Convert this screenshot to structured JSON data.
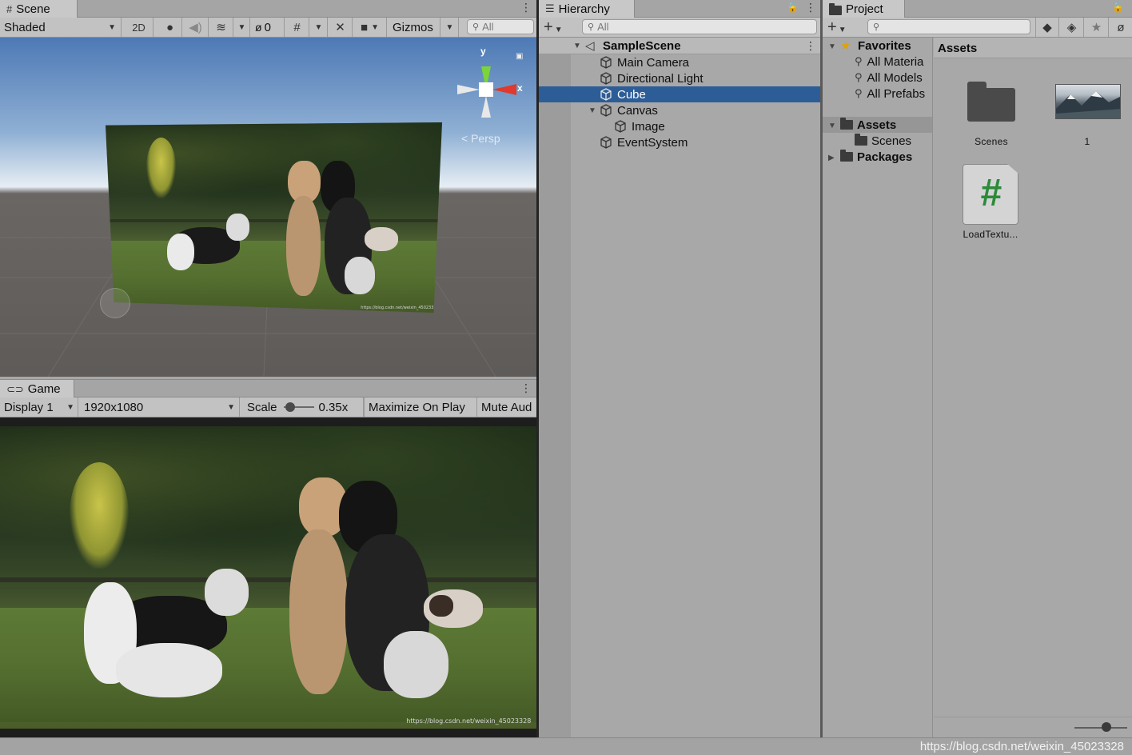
{
  "scene": {
    "tab_label": "Scene",
    "shading_mode": "Shaded",
    "btn_2d": "2D",
    "hidden_count": "0",
    "gizmos_label": "Gizmos",
    "search_placeholder": "All",
    "axis_y": "y",
    "axis_x": "x",
    "persp_label": "Persp"
  },
  "game": {
    "tab_label": "Game",
    "display": "Display 1",
    "resolution": "1920x1080",
    "scale_label": "Scale",
    "scale_value": "0.35x",
    "maximize_label": "Maximize On Play",
    "mute_label": "Mute Aud",
    "scale_fraction": 0.08
  },
  "photo": {
    "watermark": "https://blog.csdn.net/weixin_45023328"
  },
  "hierarchy": {
    "tab_label": "Hierarchy",
    "search_placeholder": "All",
    "scene_name": "SampleScene",
    "items": [
      {
        "label": "Main Camera"
      },
      {
        "label": "Directional Light"
      },
      {
        "label": "Cube"
      },
      {
        "label": "Canvas"
      },
      {
        "label": "Image"
      },
      {
        "label": "EventSystem"
      }
    ]
  },
  "project": {
    "tab_label": "Project",
    "favorites_label": "Favorites",
    "favorites": [
      "All Materia",
      "All Models",
      "All Prefabs"
    ],
    "assets_label": "Assets",
    "assets_children": [
      "Scenes"
    ],
    "packages_label": "Packages",
    "breadcrumb": "Assets",
    "grid_items": [
      {
        "label": "Scenes"
      },
      {
        "label": "1"
      },
      {
        "label": "LoadTextu..."
      }
    ]
  },
  "status": {
    "watermark": "https://blog.csdn.net/weixin_45023328"
  },
  "colors": {
    "selection": "#2c5d97",
    "panel_bg": "#a8a8a8",
    "tab_active": "#c8c8c8",
    "gizmo_x": "#e03a2c",
    "gizmo_y": "#7bd43a",
    "script_icon": "#2d8a3a"
  }
}
